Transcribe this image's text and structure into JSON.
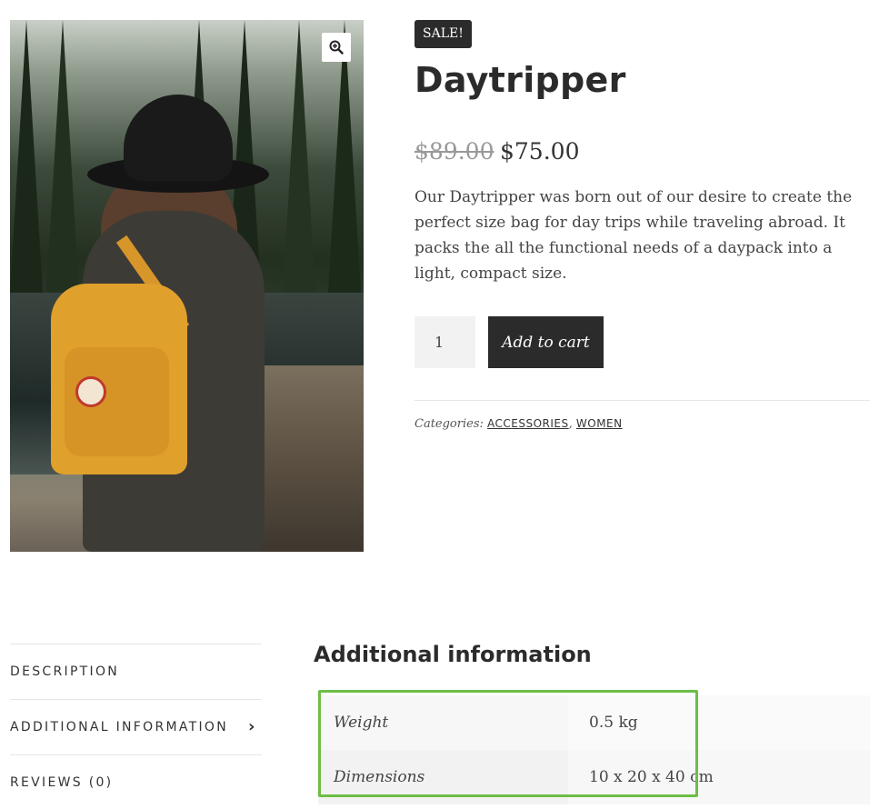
{
  "product": {
    "badge": "SALE!",
    "title": "Daytripper",
    "price_old": "$89.00",
    "price_new": "$75.00",
    "description": "Our Daytripper was born out of our desire to create the perfect size bag for day trips while traveling abroad. It packs the all the functional needs of a daypack into a light, compact size.",
    "quantity": "1",
    "add_to_cart_label": "Add to cart",
    "categories_label": "Categories:",
    "categories": [
      "ACCESSORIES",
      "WOMEN"
    ],
    "image_icon": "zoom-in-icon"
  },
  "tabs": [
    {
      "label": "DESCRIPTION"
    },
    {
      "label": "ADDITIONAL INFORMATION",
      "icon": "chevron-right-icon",
      "active": true
    },
    {
      "label": "REVIEWS (0)"
    }
  ],
  "additional_info": {
    "heading": "Additional information",
    "rows": [
      {
        "label": "Weight",
        "value": "0.5 kg"
      },
      {
        "label": "Dimensions",
        "value": "10 x 20 x 40 cm"
      }
    ]
  },
  "colors": {
    "highlight": "#6cbe45",
    "button_dark": "#2b2b2b"
  }
}
